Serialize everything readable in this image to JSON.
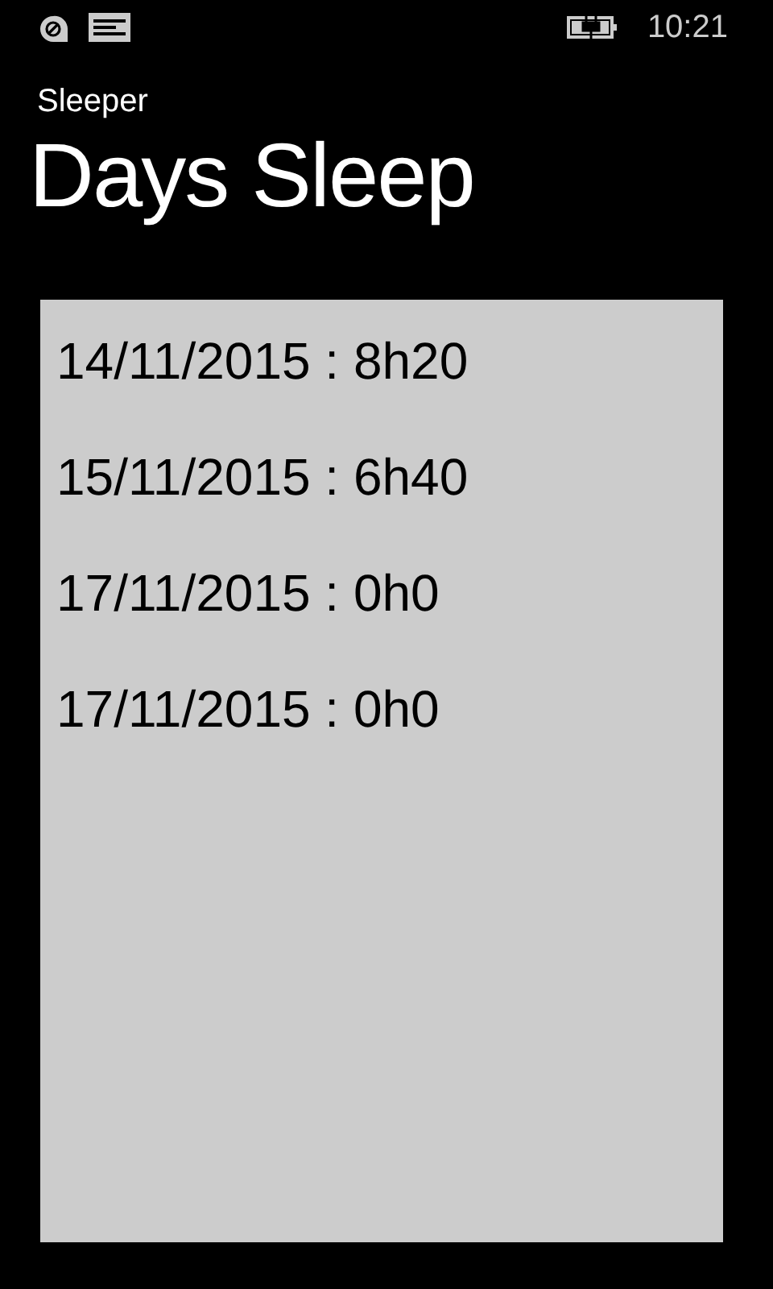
{
  "status_bar": {
    "time": "10:21"
  },
  "app_title": "Sleeper",
  "page_title": "Days Sleep",
  "entries": [
    "14/11/2015 : 8h20",
    "15/11/2015 : 6h40",
    "17/11/2015 : 0h0",
    "17/11/2015 : 0h0"
  ]
}
